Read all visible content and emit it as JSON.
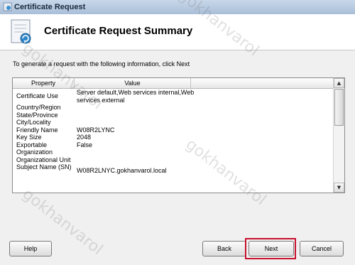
{
  "window": {
    "title": "Certificate Request"
  },
  "header": {
    "title": "Certificate Request Summary"
  },
  "content": {
    "instruction": "To generate a request with the following information, click Next",
    "table": {
      "columns": [
        "Property",
        "Value"
      ],
      "rows": [
        {
          "property": "Certificate Use",
          "value": "Server default,Web services internal,Web services external"
        },
        {
          "property": "Country/Region",
          "value": ""
        },
        {
          "property": "State/Province",
          "value": ""
        },
        {
          "property": "City/Locality",
          "value": ""
        },
        {
          "property": "Friendly Name",
          "value": "W08R2LYNC"
        },
        {
          "property": "Key Size",
          "value": "2048"
        },
        {
          "property": "Exportable",
          "value": "False"
        },
        {
          "property": "Organization",
          "value": ""
        },
        {
          "property": "Organizational Unit",
          "value": ""
        },
        {
          "property": "Subject Name (SN)",
          "value": "W08R2LNYC.gokhanvarol.local"
        }
      ]
    }
  },
  "buttons": {
    "help": "Help",
    "back": "Back",
    "next": "Next",
    "cancel": "Cancel"
  },
  "watermark": "gokhanvarol"
}
